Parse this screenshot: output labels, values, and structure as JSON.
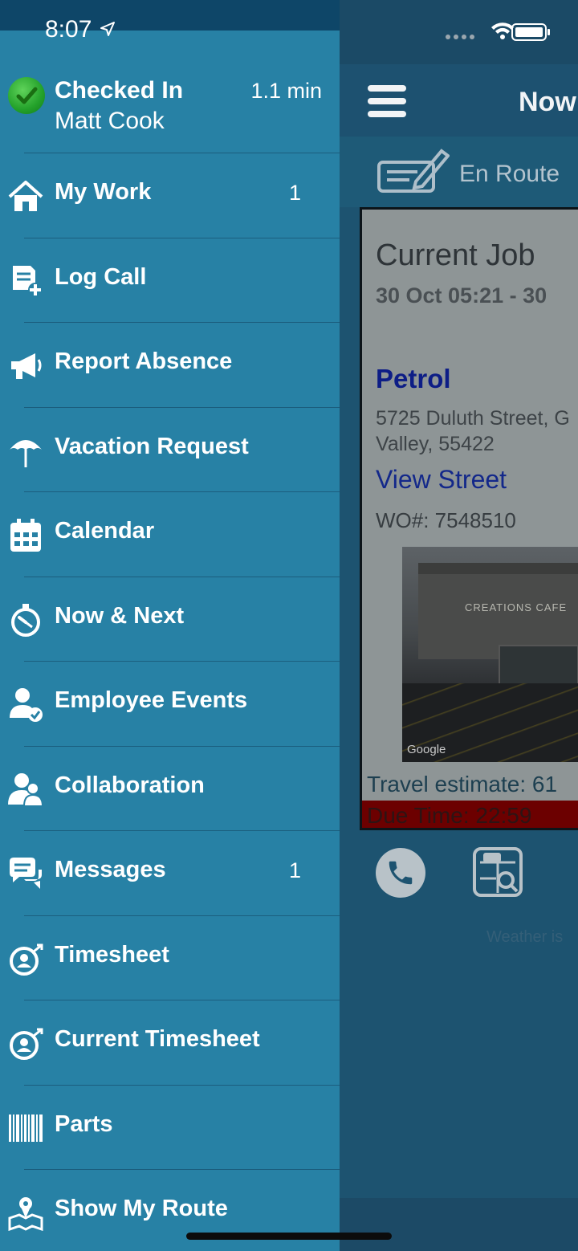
{
  "status_bar": {
    "time": "8:07"
  },
  "header": {
    "title": "Now"
  },
  "job_status": {
    "label": "En Route"
  },
  "current_job": {
    "title": "Current Job",
    "dates": "30 Oct 05:21 - 30",
    "customer": "Petrol",
    "address_line1": "5725 Duluth Street, G",
    "address_line2": "Valley, 55422",
    "view_street": "View Street",
    "wo": "WO#: 7548510",
    "photo_sign": "CREATIONS CAFE",
    "photo_credit": "Google",
    "travel_estimate": "Travel estimate: 61",
    "due_time": "Due Time: 22:59"
  },
  "weather_text": "Weather is",
  "drawer": {
    "checkin": {
      "status": "Checked In",
      "name": "Matt Cook",
      "elapsed": "1.1 min"
    },
    "items": [
      {
        "label": "My Work",
        "icon": "home-icon",
        "badge": "1"
      },
      {
        "label": "Log Call",
        "icon": "log-call-icon",
        "badge": ""
      },
      {
        "label": "Report Absence",
        "icon": "megaphone-icon",
        "badge": ""
      },
      {
        "label": "Vacation Request",
        "icon": "umbrella-icon",
        "badge": ""
      },
      {
        "label": "Calendar",
        "icon": "calendar-icon",
        "badge": ""
      },
      {
        "label": "Now & Next",
        "icon": "stopwatch-icon",
        "badge": ""
      },
      {
        "label": "Employee Events",
        "icon": "person-check-icon",
        "badge": ""
      },
      {
        "label": "Collaboration",
        "icon": "people-icon",
        "badge": ""
      },
      {
        "label": "Messages",
        "icon": "chat-bubbles-icon",
        "badge": "1"
      },
      {
        "label": "Timesheet",
        "icon": "timesheet-icon",
        "badge": ""
      },
      {
        "label": "Current Timesheet",
        "icon": "timesheet-icon",
        "badge": ""
      },
      {
        "label": "Parts",
        "icon": "barcode-icon",
        "badge": ""
      },
      {
        "label": "Show My Route",
        "icon": "route-map-icon",
        "badge": ""
      }
    ]
  },
  "colors": {
    "drawer_bg": "#2781a5",
    "status_bg": "#0e4668",
    "checkin_green": "#23a12a",
    "due_bar": "#6c0000"
  }
}
